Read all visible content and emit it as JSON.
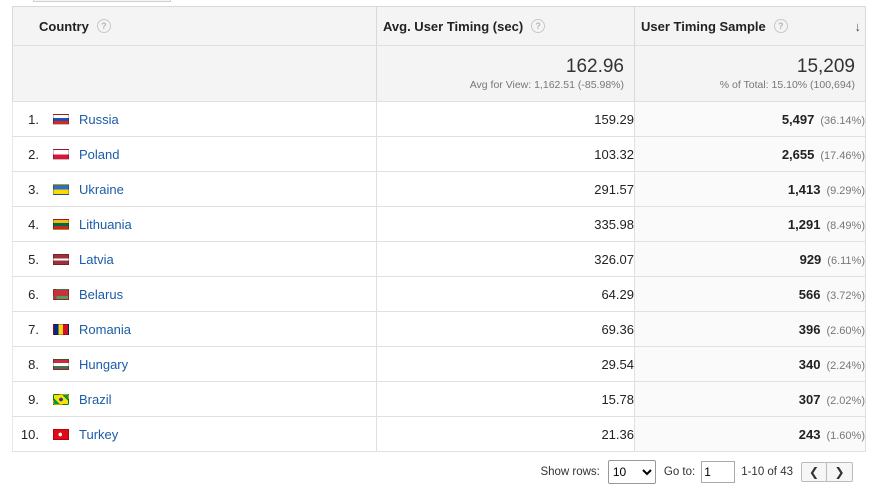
{
  "headers": {
    "country": "Country",
    "avg_timing": "Avg. User Timing (sec)",
    "sample": "User Timing Sample",
    "help_glyph": "?",
    "sort_glyph": "↓"
  },
  "summary": {
    "avg_timing_value": "162.96",
    "avg_timing_sub": "Avg for View: 1,162.51 (-85.98%)",
    "sample_value": "15,209",
    "sample_sub": "% of Total: 15.10% (100,694)"
  },
  "rows": [
    {
      "rank": "1.",
      "flag": "russia-flag-icon",
      "country": "Russia",
      "avg": "159.29",
      "sample": "5,497",
      "pct": "(36.14%)"
    },
    {
      "rank": "2.",
      "flag": "poland-flag-icon",
      "country": "Poland",
      "avg": "103.32",
      "sample": "2,655",
      "pct": "(17.46%)"
    },
    {
      "rank": "3.",
      "flag": "ukraine-flag-icon",
      "country": "Ukraine",
      "avg": "291.57",
      "sample": "1,413",
      "pct": "(9.29%)"
    },
    {
      "rank": "4.",
      "flag": "lithuania-flag-icon",
      "country": "Lithuania",
      "avg": "335.98",
      "sample": "1,291",
      "pct": "(8.49%)"
    },
    {
      "rank": "5.",
      "flag": "latvia-flag-icon",
      "country": "Latvia",
      "avg": "326.07",
      "sample": "929",
      "pct": "(6.11%)"
    },
    {
      "rank": "6.",
      "flag": "belarus-flag-icon",
      "country": "Belarus",
      "avg": "64.29",
      "sample": "566",
      "pct": "(3.72%)"
    },
    {
      "rank": "7.",
      "flag": "romania-flag-icon",
      "country": "Romania",
      "avg": "69.36",
      "sample": "396",
      "pct": "(2.60%)"
    },
    {
      "rank": "8.",
      "flag": "hungary-flag-icon",
      "country": "Hungary",
      "avg": "29.54",
      "sample": "340",
      "pct": "(2.24%)"
    },
    {
      "rank": "9.",
      "flag": "brazil-flag-icon",
      "country": "Brazil",
      "avg": "15.78",
      "sample": "307",
      "pct": "(2.02%)"
    },
    {
      "rank": "10.",
      "flag": "turkey-flag-icon",
      "country": "Turkey",
      "avg": "21.36",
      "sample": "243",
      "pct": "(1.60%)"
    }
  ],
  "pager": {
    "show_rows_label": "Show rows:",
    "show_rows_value": "10",
    "goto_label": "Go to:",
    "goto_value": "1",
    "range_text": "1-10 of 43",
    "prev_glyph": "❮",
    "next_glyph": "❯"
  },
  "colors": {
    "link": "#1a5ca8",
    "header_bg": "#f4f4f4",
    "border": "#e0e0e0"
  }
}
